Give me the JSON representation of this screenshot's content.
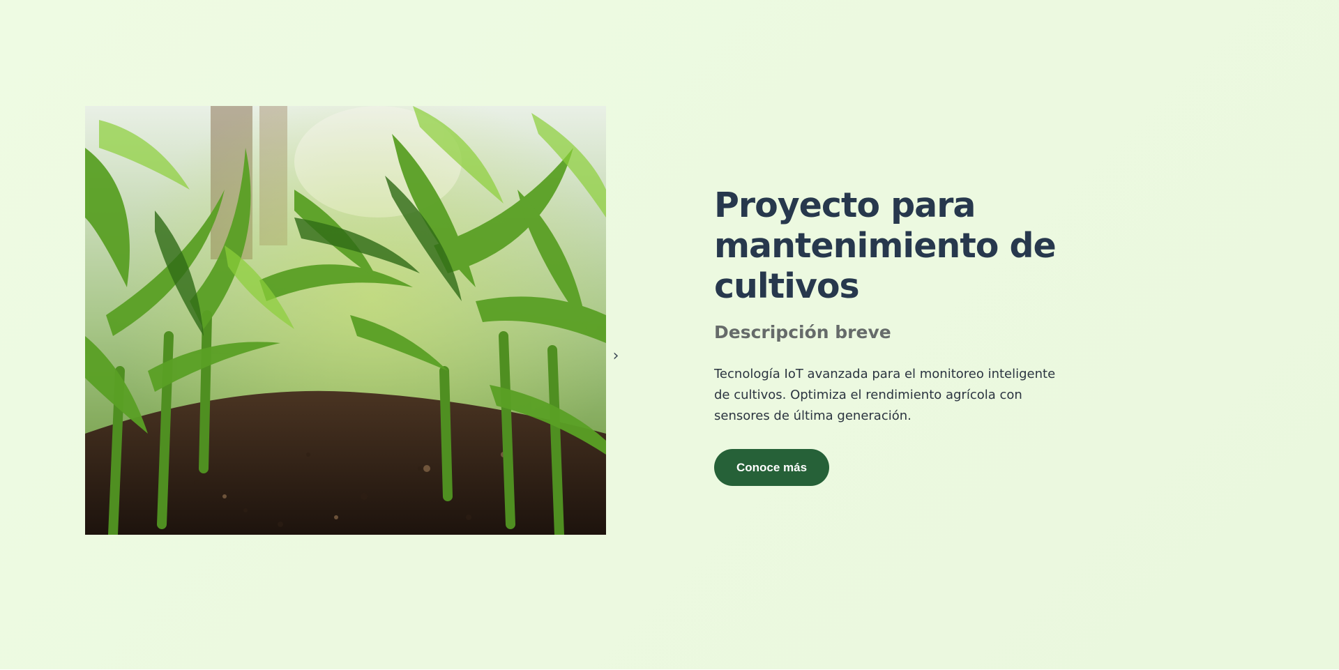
{
  "hero": {
    "image": {
      "alt": "",
      "icon": "corn-field-photo"
    },
    "next_arrow": "›",
    "title": "Proyecto para mantenimiento de cultivos",
    "subtitle": "Descripción breve",
    "description": "Tecnología IoT avanzada para el monitoreo inteligente de cultivos. Optimiza el rendimiento agrícola con sensores de última generación.",
    "cta_label": "Conoce más"
  },
  "colors": {
    "background": "#eefbe3",
    "title": "#27384d",
    "subtitle": "#666b6a",
    "text": "#2b3440",
    "button": "#266138",
    "button_text": "#ffffff"
  }
}
